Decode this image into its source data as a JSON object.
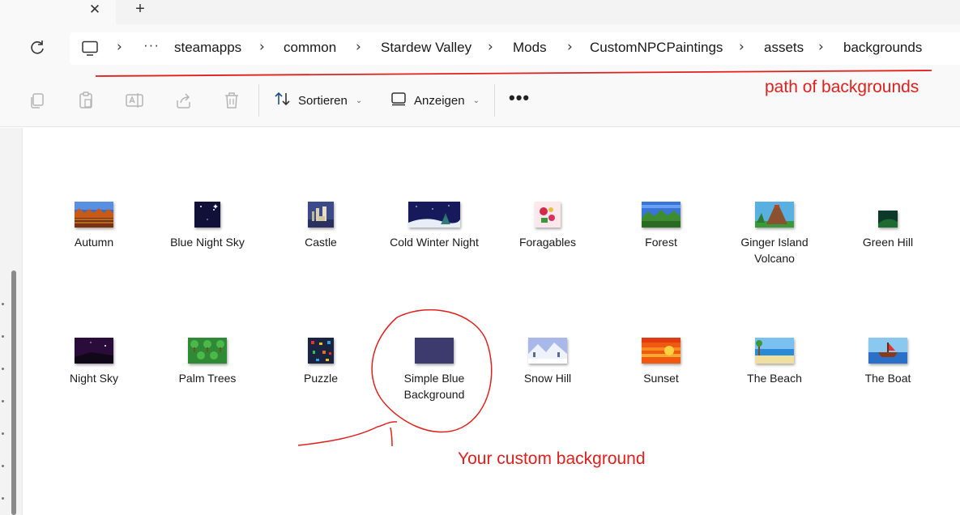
{
  "tabstrip": {
    "close_icon": "close-icon",
    "new_tab_icon": "plus-icon",
    "close_glyph": "✕",
    "new_glyph": "+"
  },
  "address": {
    "refresh_icon": "refresh-icon",
    "root_icon": "computer-icon",
    "overflow": "···",
    "crumbs": [
      "steamapps",
      "common",
      "Stardew Valley",
      "Mods",
      "CustomNPCPaintings",
      "assets",
      "backgrounds"
    ]
  },
  "toolbar": {
    "copy_icon": "copy-icon",
    "paste_icon": "paste-icon",
    "rename_icon": "rename-icon",
    "share_icon": "share-icon",
    "delete_icon": "trash-icon",
    "sort_label": "Sortieren",
    "view_label": "Anzeigen",
    "more_label": "•••"
  },
  "files": [
    {
      "name": "Autumn",
      "thumb": "autumn"
    },
    {
      "name": "Blue Night Sky",
      "thumb": "bluenight"
    },
    {
      "name": "Castle",
      "thumb": "castle"
    },
    {
      "name": "Cold Winter Night",
      "thumb": "coldwinter"
    },
    {
      "name": "Foragables",
      "thumb": "foragables"
    },
    {
      "name": "Forest",
      "thumb": "forest"
    },
    {
      "name": "Ginger Island Volcano",
      "thumb": "volcano"
    },
    {
      "name": "Green Hill",
      "thumb": "greenhill"
    },
    {
      "name": "Night Sky",
      "thumb": "nightsky"
    },
    {
      "name": "Palm Trees",
      "thumb": "palmtrees"
    },
    {
      "name": "Puzzle",
      "thumb": "puzzle"
    },
    {
      "name": "Simple Blue Background",
      "thumb": "simpleblue"
    },
    {
      "name": "Snow Hill",
      "thumb": "snowhill"
    },
    {
      "name": "Sunset",
      "thumb": "sunset"
    },
    {
      "name": "The Beach",
      "thumb": "beach"
    },
    {
      "name": "The Boat",
      "thumb": "boat"
    }
  ],
  "annotations": {
    "path_note": "path of backgrounds",
    "custom_note": "Your custom background",
    "color": "#e0201c"
  },
  "colors": {
    "simple_blue": "#3d3a6e"
  }
}
